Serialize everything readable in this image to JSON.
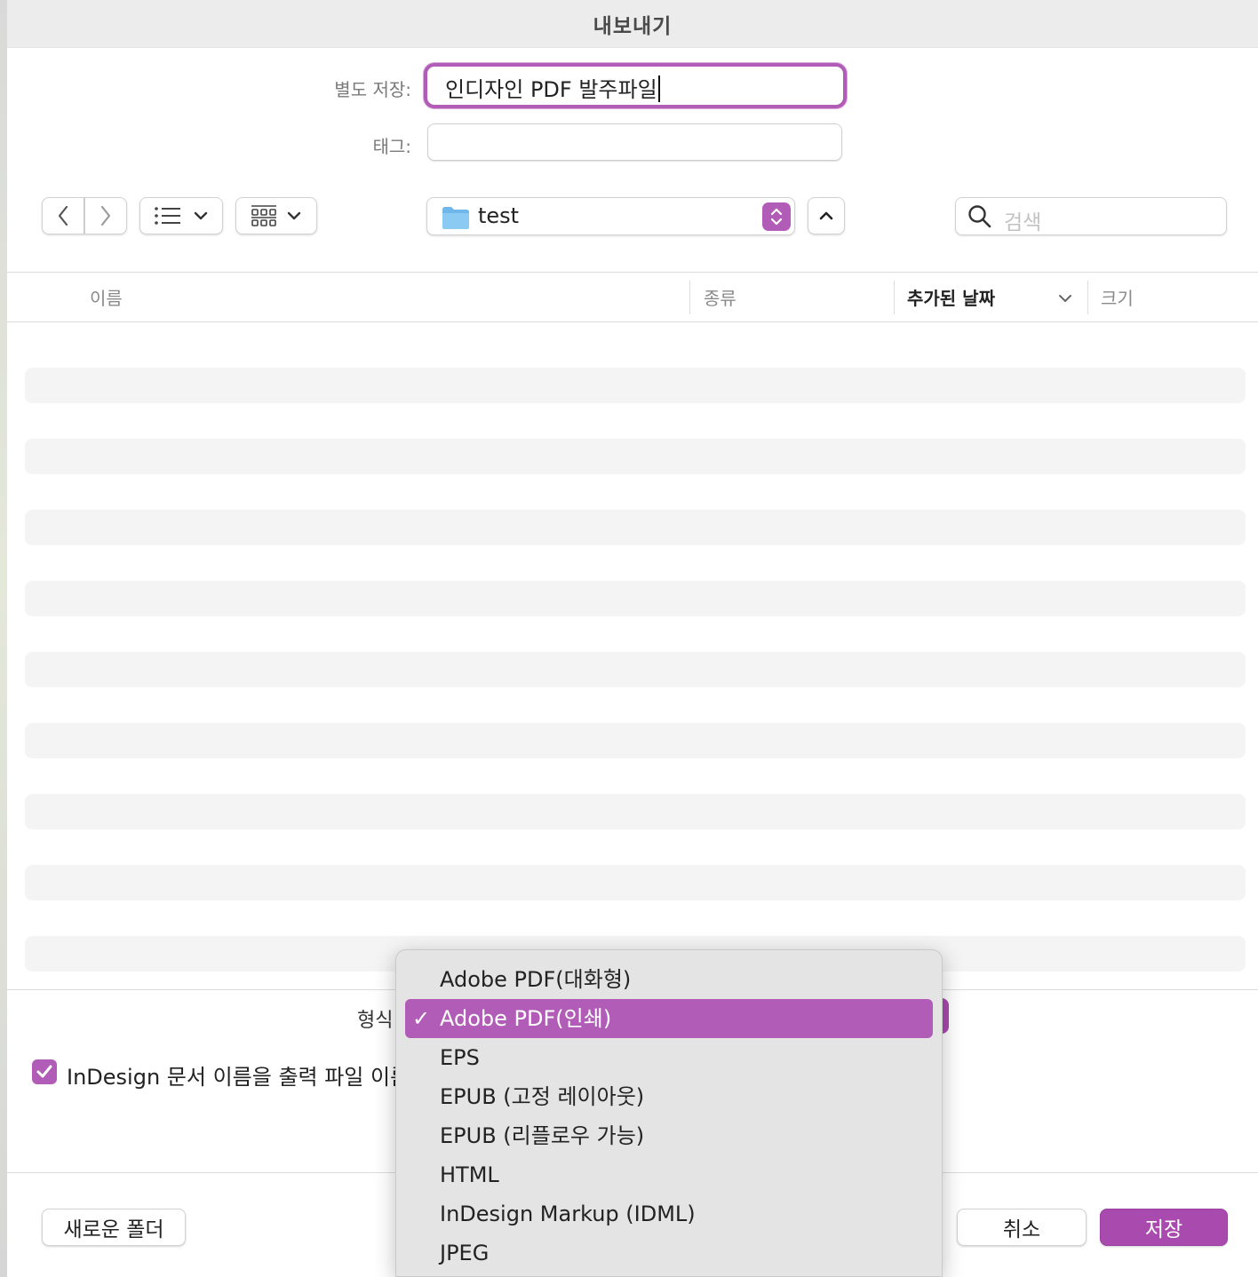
{
  "window": {
    "title": "내보내기"
  },
  "save_as": {
    "label": "별도 저장:",
    "value": "인디자인 PDF 발주파일"
  },
  "tags": {
    "label": "태그:",
    "value": ""
  },
  "toolbar": {
    "location": "test",
    "search_placeholder": "검색"
  },
  "columns": [
    {
      "label": "이름"
    },
    {
      "label": "종류"
    },
    {
      "label": "추가된 날짜",
      "sorted": true
    },
    {
      "label": "크기"
    }
  ],
  "file_rows": [],
  "format": {
    "label": "형식",
    "selected": "Adobe PDF(인쇄)"
  },
  "format_menu": {
    "items": [
      {
        "label": "Adobe PDF(대화형)",
        "selected": false
      },
      {
        "label": "Adobe PDF(인쇄)",
        "selected": true
      },
      {
        "label": "EPS",
        "selected": false
      },
      {
        "label": "EPUB (고정 레이아웃)",
        "selected": false
      },
      {
        "label": "EPUB (리플로우 가능)",
        "selected": false
      },
      {
        "label": "HTML",
        "selected": false
      },
      {
        "label": "InDesign Markup (IDML)",
        "selected": false
      },
      {
        "label": "JPEG",
        "selected": false
      }
    ],
    "check_glyph": "✓"
  },
  "option_checkbox": {
    "label": "InDesign 문서 이름을 출력 파일 이름",
    "checked": true
  },
  "buttons": {
    "new_folder": "새로운 폴더",
    "cancel": "취소",
    "save": "저장"
  },
  "colors": {
    "accent": "#b15cb6"
  }
}
